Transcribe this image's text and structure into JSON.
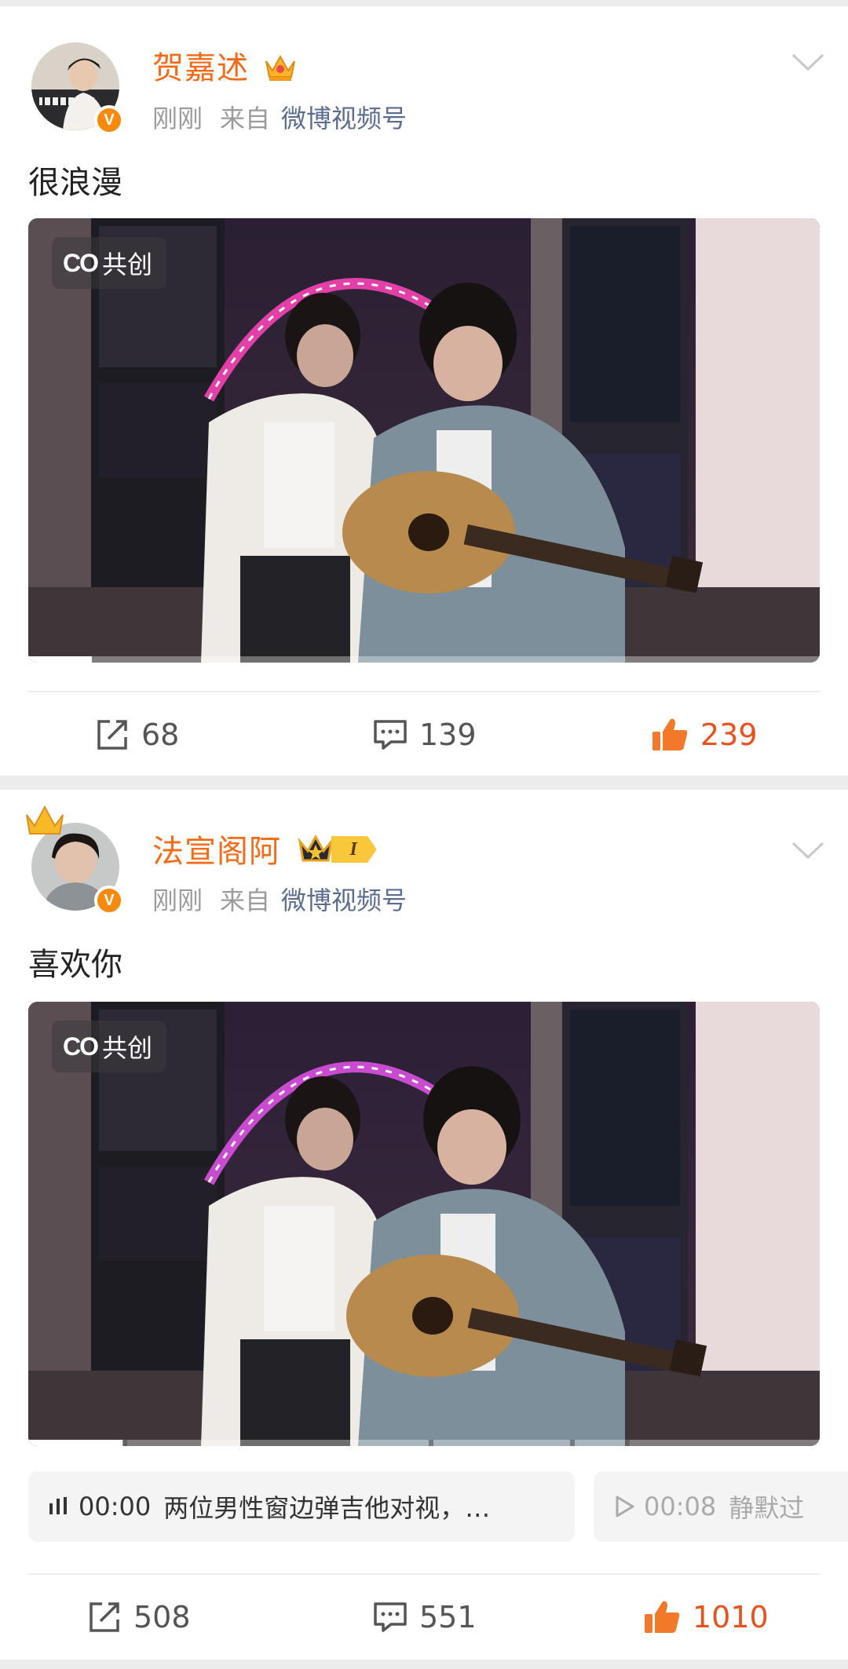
{
  "posts": [
    {
      "username": "贺嘉述",
      "time": "刚刚",
      "from_label": "来自",
      "source": "微博视频号",
      "text": "很浪漫",
      "cocreate_label": "共创",
      "cocreate_icon": "co-icon",
      "progress": 0.08,
      "actions": {
        "repost": "68",
        "comment": "139",
        "like": "239"
      }
    },
    {
      "username": "法宣阁阿",
      "level_badge": "I",
      "time": "刚刚",
      "from_label": "来自",
      "source": "微博视频号",
      "text": "喜欢你",
      "cocreate_label": "共创",
      "cocreate_icon": "co-icon",
      "progress": 0.12,
      "chapters": [
        {
          "time": "00:00",
          "text": "两位男性窗边弹吉他对视，…"
        },
        {
          "time": "00:08",
          "text": "静默过"
        }
      ],
      "actions": {
        "repost": "508",
        "comment": "551",
        "like": "1010"
      }
    }
  ],
  "colors": {
    "username": "#f46a16",
    "source_link": "#5b6d8f",
    "like_active": "#e8521d",
    "verified_badge": "#f7890c"
  }
}
